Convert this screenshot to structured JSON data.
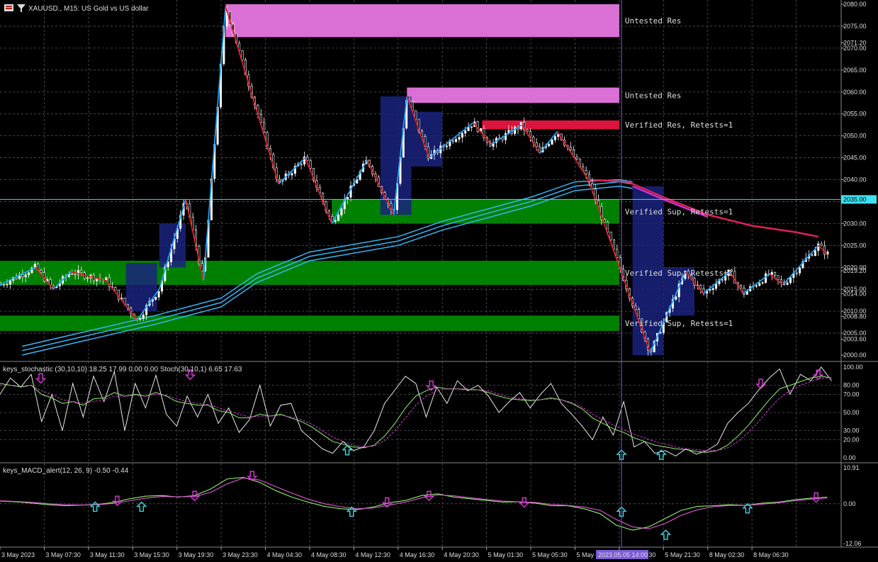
{
  "header": {
    "title": "XAUUSD., M15:  US Gold vs US dollar",
    "stoch_title": "keys_stochastic (30,10,10) 18.25 17.99 0.00 0.00 Stoch(30,10,1) 6.65 17.63",
    "macd_title": "keys_MACD_alert(12, 26, 9) -0.50 -0.44",
    "cursor_time": "2023.05.05 14:00"
  },
  "colors": {
    "background": "#000000",
    "bull": "#ffffff",
    "bear": "#ffffff",
    "zigzag_up": "#1ea0ff",
    "zigzag_down": "#e0202a",
    "res_untested": "#da70d6",
    "res_verified": "#dc143c",
    "sup_verified": "#008000",
    "ma_blue": "#35b7f5",
    "ma_red": "#e0205a",
    "ma_pink": "#cc33cc",
    "up_arrow": "#3ed6e0",
    "down_arrow": "#d83bd8",
    "cursor": "#7b5bd6",
    "hline": "#40e0f0"
  },
  "chart_data": [
    {
      "type": "candlestick",
      "symbol": "XAUUSD.",
      "timeframe": "M15",
      "ylim": [
        2000,
        2080
      ],
      "y_ticks": [
        2000.0,
        2003.6,
        2005.0,
        2008.8,
        2010.0,
        2014.0,
        2015.0,
        2019.2,
        2020.0,
        2025.0,
        2030.0,
        2035.0,
        2040.0,
        2045.0,
        2050.0,
        2055.0,
        2060.0,
        2065.0,
        2070.0,
        2071.2,
        2075.0,
        2080.0
      ],
      "y_tick_labels": [
        "2000.00",
        "2003.60",
        "2005.00",
        "2008.80",
        "2010.00",
        "2014.00",
        "2015.00",
        "2019.20",
        "2020.00",
        "2025.00",
        "2030.00",
        "2035.00",
        "2040.00",
        "2045.00",
        "2050.00",
        "2055.00",
        "2060.00",
        "2065.00",
        "2070.00",
        "2071.20",
        "2075.00",
        "2080.00"
      ],
      "current_price_label": "2035.00",
      "x_ticks": [
        "3 May 2023",
        "3 May 07:30",
        "3 May 11:30",
        "3 May 15:30",
        "3 May 19:30",
        "3 May 23:30",
        "4 May 04:30",
        "4 May 08:30",
        "4 May 12:30",
        "4 May 16:30",
        "4 May 20:30",
        "5 May 01:30",
        "5 May 05:30",
        "5 May 0",
        "5 May 17:30",
        "5 May 21:30",
        "8 May 02:30",
        "8 May 06:30"
      ],
      "zigzag": [
        [
          0,
          2016
        ],
        [
          0.8,
          2020
        ],
        [
          1.2,
          2015
        ],
        [
          1.6,
          2019
        ],
        [
          2.4,
          2017
        ],
        [
          3.1,
          2008
        ],
        [
          3.6,
          2015
        ],
        [
          4.2,
          2035.5
        ],
        [
          4.6,
          2017
        ],
        [
          5.1,
          2079.5
        ],
        [
          6.3,
          2039
        ],
        [
          6.9,
          2045
        ],
        [
          7.5,
          2030
        ],
        [
          8.3,
          2044.5
        ],
        [
          8.9,
          2032
        ],
        [
          9.2,
          2059
        ],
        [
          9.7,
          2045
        ],
        [
          10.7,
          2053
        ],
        [
          11.1,
          2048
        ],
        [
          11.8,
          2052.5
        ],
        [
          12.2,
          2046
        ],
        [
          12.6,
          2051
        ],
        [
          13.3,
          2040
        ],
        [
          14.7,
          2000.5
        ],
        [
          15.5,
          2019
        ],
        [
          15.9,
          2014
        ],
        [
          16.5,
          2019
        ],
        [
          16.8,
          2014
        ],
        [
          17.4,
          2018.5
        ],
        [
          17.7,
          2016
        ],
        [
          18.5,
          2025
        ],
        [
          18.7,
          2023
        ]
      ],
      "zones": [
        {
          "label": "Untested Res",
          "kind": "res_untested",
          "from": 2072.5,
          "to": 2080,
          "x0": 5.1,
          "x1": 14.0
        },
        {
          "label": "Untested Res",
          "kind": "res_untested",
          "from": 2057.5,
          "to": 2061,
          "x0": 9.2,
          "x1": 14.0
        },
        {
          "label": "Verified Res, Retests=1",
          "kind": "res_verified",
          "from": 2051.5,
          "to": 2053.5,
          "x0": 10.9,
          "x1": 14.0
        },
        {
          "label": "Verified Sup, Retests=1",
          "kind": "sup_verified",
          "from": 2030,
          "to": 2035.5,
          "x0": 7.5,
          "x1": 14.0
        },
        {
          "label": "Verified Sup, Retests=1",
          "kind": "sup_verified",
          "from": 2016,
          "to": 2021.5,
          "x0": 0,
          "x1": 14.0
        },
        {
          "label": "Verified Sup, Retests=1",
          "kind": "sup_verified",
          "from": 2005.5,
          "to": 2009,
          "x0": 0,
          "x1": 14.0
        }
      ],
      "boxes": [
        {
          "from": 2010,
          "to": 2021,
          "x0": 2.85,
          "x1": 3.55
        },
        {
          "from": 2020,
          "to": 2030,
          "x0": 3.6,
          "x1": 4.2
        },
        {
          "from": 2032,
          "to": 2059,
          "x0": 8.6,
          "x1": 9.3
        },
        {
          "from": 2043,
          "to": 2055.5,
          "x0": 9.3,
          "x1": 10.0
        },
        {
          "from": 2000,
          "to": 2038.5,
          "x0": 14.3,
          "x1": 15.0
        },
        {
          "from": 2009,
          "to": 2020,
          "x0": 15.0,
          "x1": 15.7
        }
      ],
      "ma_series": [
        {
          "color": "ma_blue",
          "points": [
            [
              0.5,
              2000
            ],
            [
              2,
              2003.5
            ],
            [
              3.5,
              2007
            ],
            [
              5,
              2011
            ],
            [
              5.8,
              2016.5
            ],
            [
              7,
              2021.5
            ],
            [
              9,
              2025
            ],
            [
              10,
              2028.5
            ],
            [
              12,
              2034
            ],
            [
              13,
              2037.5
            ],
            [
              14,
              2038.5
            ],
            [
              14.3,
              2038
            ]
          ]
        },
        {
          "color": "ma_blue",
          "points": [
            [
              0.5,
              2001
            ],
            [
              2,
              2004.5
            ],
            [
              3.5,
              2008
            ],
            [
              5,
              2012
            ],
            [
              5.8,
              2017.5
            ],
            [
              7,
              2022.5
            ],
            [
              9,
              2026
            ],
            [
              10,
              2029.5
            ],
            [
              12,
              2035
            ],
            [
              13,
              2038.5
            ],
            [
              14,
              2039.5
            ],
            [
              14.3,
              2039
            ]
          ]
        },
        {
          "color": "ma_blue",
          "points": [
            [
              0.5,
              2002
            ],
            [
              2,
              2005.5
            ],
            [
              3.5,
              2009
            ],
            [
              5,
              2013
            ],
            [
              5.8,
              2018.5
            ],
            [
              7,
              2023.5
            ],
            [
              9,
              2027
            ],
            [
              10,
              2030.5
            ],
            [
              12,
              2036
            ],
            [
              13,
              2039.5
            ],
            [
              14,
              2040
            ],
            [
              14.3,
              2039.5
            ]
          ]
        },
        {
          "color": "ma_pink",
          "points": [
            [
              14.3,
              2038.5
            ],
            [
              15.0,
              2035.5
            ],
            [
              16.0,
              2031.5
            ]
          ]
        },
        {
          "color": "ma_red",
          "points": [
            [
              13.3,
              2040
            ],
            [
              14.2,
              2039.5
            ],
            [
              15,
              2036
            ],
            [
              16,
              2032
            ],
            [
              17,
              2029.5
            ],
            [
              18,
              2028
            ],
            [
              18.5,
              2027
            ]
          ]
        }
      ],
      "cursor_x": 14.05,
      "hline_y": 2035.5
    },
    {
      "type": "line",
      "name_text": "keys_stochastic",
      "ylim": [
        0,
        100
      ],
      "y_ticks": [
        0,
        20,
        30,
        50,
        70,
        80,
        100
      ],
      "y_tick_labels": [
        "0.00",
        "20.00",
        "30.00",
        "50.00",
        "70.00",
        "80.00",
        "100.00"
      ],
      "series": [
        {
          "color": "#e8e8e8",
          "values": [
            70,
            88,
            78,
            92,
            40,
            70,
            30,
            82,
            45,
            90,
            62,
            95,
            30,
            82,
            55,
            91,
            48,
            35,
            68,
            45,
            70,
            38,
            55,
            28,
            42,
            80,
            35,
            58,
            60,
            30,
            20,
            10,
            5,
            18,
            8,
            12,
            30,
            60,
            75,
            90,
            82,
            45,
            78,
            60,
            85,
            74,
            80,
            68,
            50,
            62,
            72,
            55,
            70,
            82,
            60,
            48,
            35,
            20,
            45,
            25,
            62,
            12,
            18,
            5,
            8,
            2,
            10,
            4,
            8,
            15,
            38,
            50,
            60,
            75,
            88,
            98,
            70,
            92,
            85,
            100,
            85
          ]
        },
        {
          "color": "#8fef6a",
          "values": [
            82,
            80,
            78,
            80,
            70,
            66,
            60,
            62,
            58,
            65,
            66,
            72,
            68,
            70,
            68,
            72,
            68,
            62,
            60,
            58,
            58,
            52,
            50,
            44,
            44,
            48,
            46,
            48,
            44,
            40,
            34,
            26,
            18,
            15,
            12,
            11,
            14,
            24,
            38,
            55,
            68,
            74,
            78,
            76,
            76,
            75,
            75,
            72,
            68,
            65,
            64,
            63,
            64,
            66,
            64,
            60,
            54,
            44,
            38,
            32,
            28,
            22,
            18,
            14,
            12,
            10,
            9,
            7,
            6,
            8,
            14,
            24,
            36,
            50,
            64,
            76,
            80,
            84,
            88,
            90,
            88
          ]
        },
        {
          "color": "#d83bd8",
          "dash": true,
          "values": [
            80,
            80,
            79,
            80,
            74,
            70,
            64,
            62,
            60,
            62,
            64,
            68,
            68,
            69,
            68,
            70,
            69,
            65,
            62,
            60,
            59,
            55,
            52,
            48,
            45,
            46,
            46,
            47,
            45,
            42,
            37,
            30,
            23,
            18,
            14,
            12,
            13,
            19,
            30,
            44,
            58,
            68,
            74,
            76,
            76,
            76,
            75,
            74,
            70,
            67,
            65,
            64,
            64,
            65,
            64,
            61,
            56,
            48,
            42,
            36,
            31,
            26,
            22,
            18,
            15,
            12,
            10,
            9,
            8,
            8,
            11,
            18,
            28,
            40,
            54,
            66,
            74,
            80,
            84,
            88,
            88
          ]
        }
      ],
      "arrows": [
        {
          "dir": "down",
          "x": 0.92,
          "y": 88
        },
        {
          "dir": "down",
          "x": 4.3,
          "y": 92
        },
        {
          "dir": "up",
          "x": 7.85,
          "y": 8
        },
        {
          "dir": "down",
          "x": 9.75,
          "y": 80
        },
        {
          "dir": "up",
          "x": 14.05,
          "y": 3
        },
        {
          "dir": "up",
          "x": 14.95,
          "y": 3
        },
        {
          "dir": "down",
          "x": 17.2,
          "y": 82
        },
        {
          "dir": "down",
          "x": 18.5,
          "y": 92
        }
      ]
    },
    {
      "type": "line",
      "name_text": "keys_MACD_alert",
      "ylim": [
        -12.06,
        10.91
      ],
      "y_ticks": [
        10.91,
        0.0,
        -12.06
      ],
      "y_tick_labels": [
        "10.91",
        "0.00",
        "-12.06"
      ],
      "series": [
        {
          "color": "#8fef6a",
          "values": [
            0.8,
            0.6,
            0.2,
            -0.3,
            -0.6,
            -0.4,
            -0.2,
            0.4,
            1.5,
            2.3,
            2.5,
            2.0,
            2.5,
            4.5,
            7.5,
            8.0,
            6.5,
            4.0,
            2.0,
            0.5,
            -0.8,
            -1.5,
            -1.8,
            -1.0,
            0.3,
            1.0,
            2.5,
            3.0,
            2.0,
            1.5,
            1.0,
            0.5,
            0.6,
            0.2,
            -0.6,
            -0.6,
            -1.5,
            -3.0,
            -6.5,
            -8.0,
            -7.0,
            -4.5,
            -2.0,
            -0.8,
            -0.6,
            -0.3,
            -0.5,
            0.2,
            0.5,
            1.2,
            1.7,
            2.0
          ]
        },
        {
          "color": "#e05ad6",
          "values": [
            0.9,
            0.7,
            0.4,
            0.0,
            -0.3,
            -0.4,
            -0.3,
            0.1,
            0.9,
            1.7,
            2.2,
            2.1,
            2.2,
            3.5,
            6.0,
            7.8,
            7.2,
            5.2,
            3.2,
            1.4,
            0.0,
            -0.9,
            -1.5,
            -1.3,
            -0.4,
            0.5,
            1.8,
            2.7,
            2.4,
            1.8,
            1.3,
            0.8,
            0.6,
            0.4,
            -0.2,
            -0.5,
            -1.0,
            -2.0,
            -4.8,
            -7.0,
            -7.6,
            -6.0,
            -3.5,
            -1.8,
            -0.9,
            -0.5,
            -0.5,
            -0.1,
            0.3,
            0.9,
            1.4,
            1.8
          ]
        }
      ],
      "arrows": [
        {
          "dir": "up",
          "x": 2.15,
          "y": -1.0
        },
        {
          "dir": "down",
          "x": 2.65,
          "y": 1.0
        },
        {
          "dir": "up",
          "x": 3.2,
          "y": -1.0
        },
        {
          "dir": "down",
          "x": 4.4,
          "y": 2.5
        },
        {
          "dir": "down",
          "x": 5.7,
          "y": 8.5
        },
        {
          "dir": "up",
          "x": 7.95,
          "y": -2.5
        },
        {
          "dir": "down",
          "x": 8.75,
          "y": 0.5
        },
        {
          "dir": "down",
          "x": 9.7,
          "y": 2.5
        },
        {
          "dir": "down",
          "x": 11.85,
          "y": 0.5
        },
        {
          "dir": "up",
          "x": 14.05,
          "y": -2.5
        },
        {
          "dir": "up",
          "x": 15.05,
          "y": -9.5
        },
        {
          "dir": "up",
          "x": 16.9,
          "y": -1.5
        },
        {
          "dir": "down",
          "x": 18.45,
          "y": 2.0
        }
      ]
    }
  ]
}
